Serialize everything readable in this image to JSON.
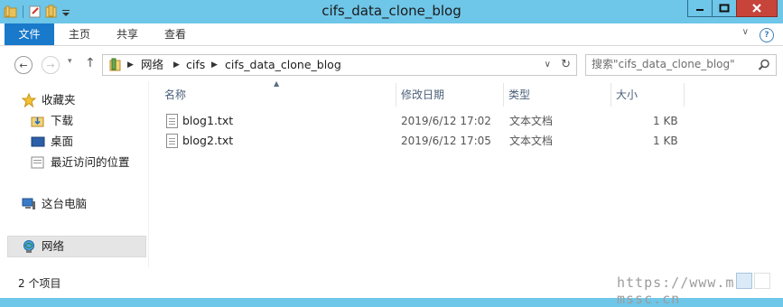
{
  "window": {
    "title": "cifs_data_clone_blog"
  },
  "ribbon": {
    "tabs": [
      {
        "label": "文件"
      },
      {
        "label": "主页"
      },
      {
        "label": "共享"
      },
      {
        "label": "查看"
      }
    ]
  },
  "address": {
    "crumbs": [
      "网络",
      "cifs",
      "cifs_data_clone_blog"
    ]
  },
  "search": {
    "placeholder": "搜索\"cifs_data_clone_blog\""
  },
  "sidebar": {
    "favorites_label": "收藏夹",
    "items": [
      {
        "label": "下载",
        "icon": "download-folder-icon"
      },
      {
        "label": "桌面",
        "icon": "desktop-icon"
      },
      {
        "label": "最近访问的位置",
        "icon": "recent-places-icon"
      }
    ],
    "this_pc": "这台电脑",
    "network": "网络"
  },
  "file_list": {
    "columns": [
      "名称",
      "修改日期",
      "类型",
      "大小"
    ],
    "rows": [
      {
        "name": "blog1.txt",
        "modified": "2019/6/12 17:02",
        "type": "文本文档",
        "size": "1 KB"
      },
      {
        "name": "blog2.txt",
        "modified": "2019/6/12 17:05",
        "type": "文本文档",
        "size": "1 KB"
      }
    ]
  },
  "status_bar": {
    "item_count": "2 个项目",
    "watermark": "https://www.mr-mssc.cn"
  },
  "colors": {
    "frame": "#6ec6e8",
    "file_tab": "#1979ca",
    "close_button": "#c7443a"
  }
}
